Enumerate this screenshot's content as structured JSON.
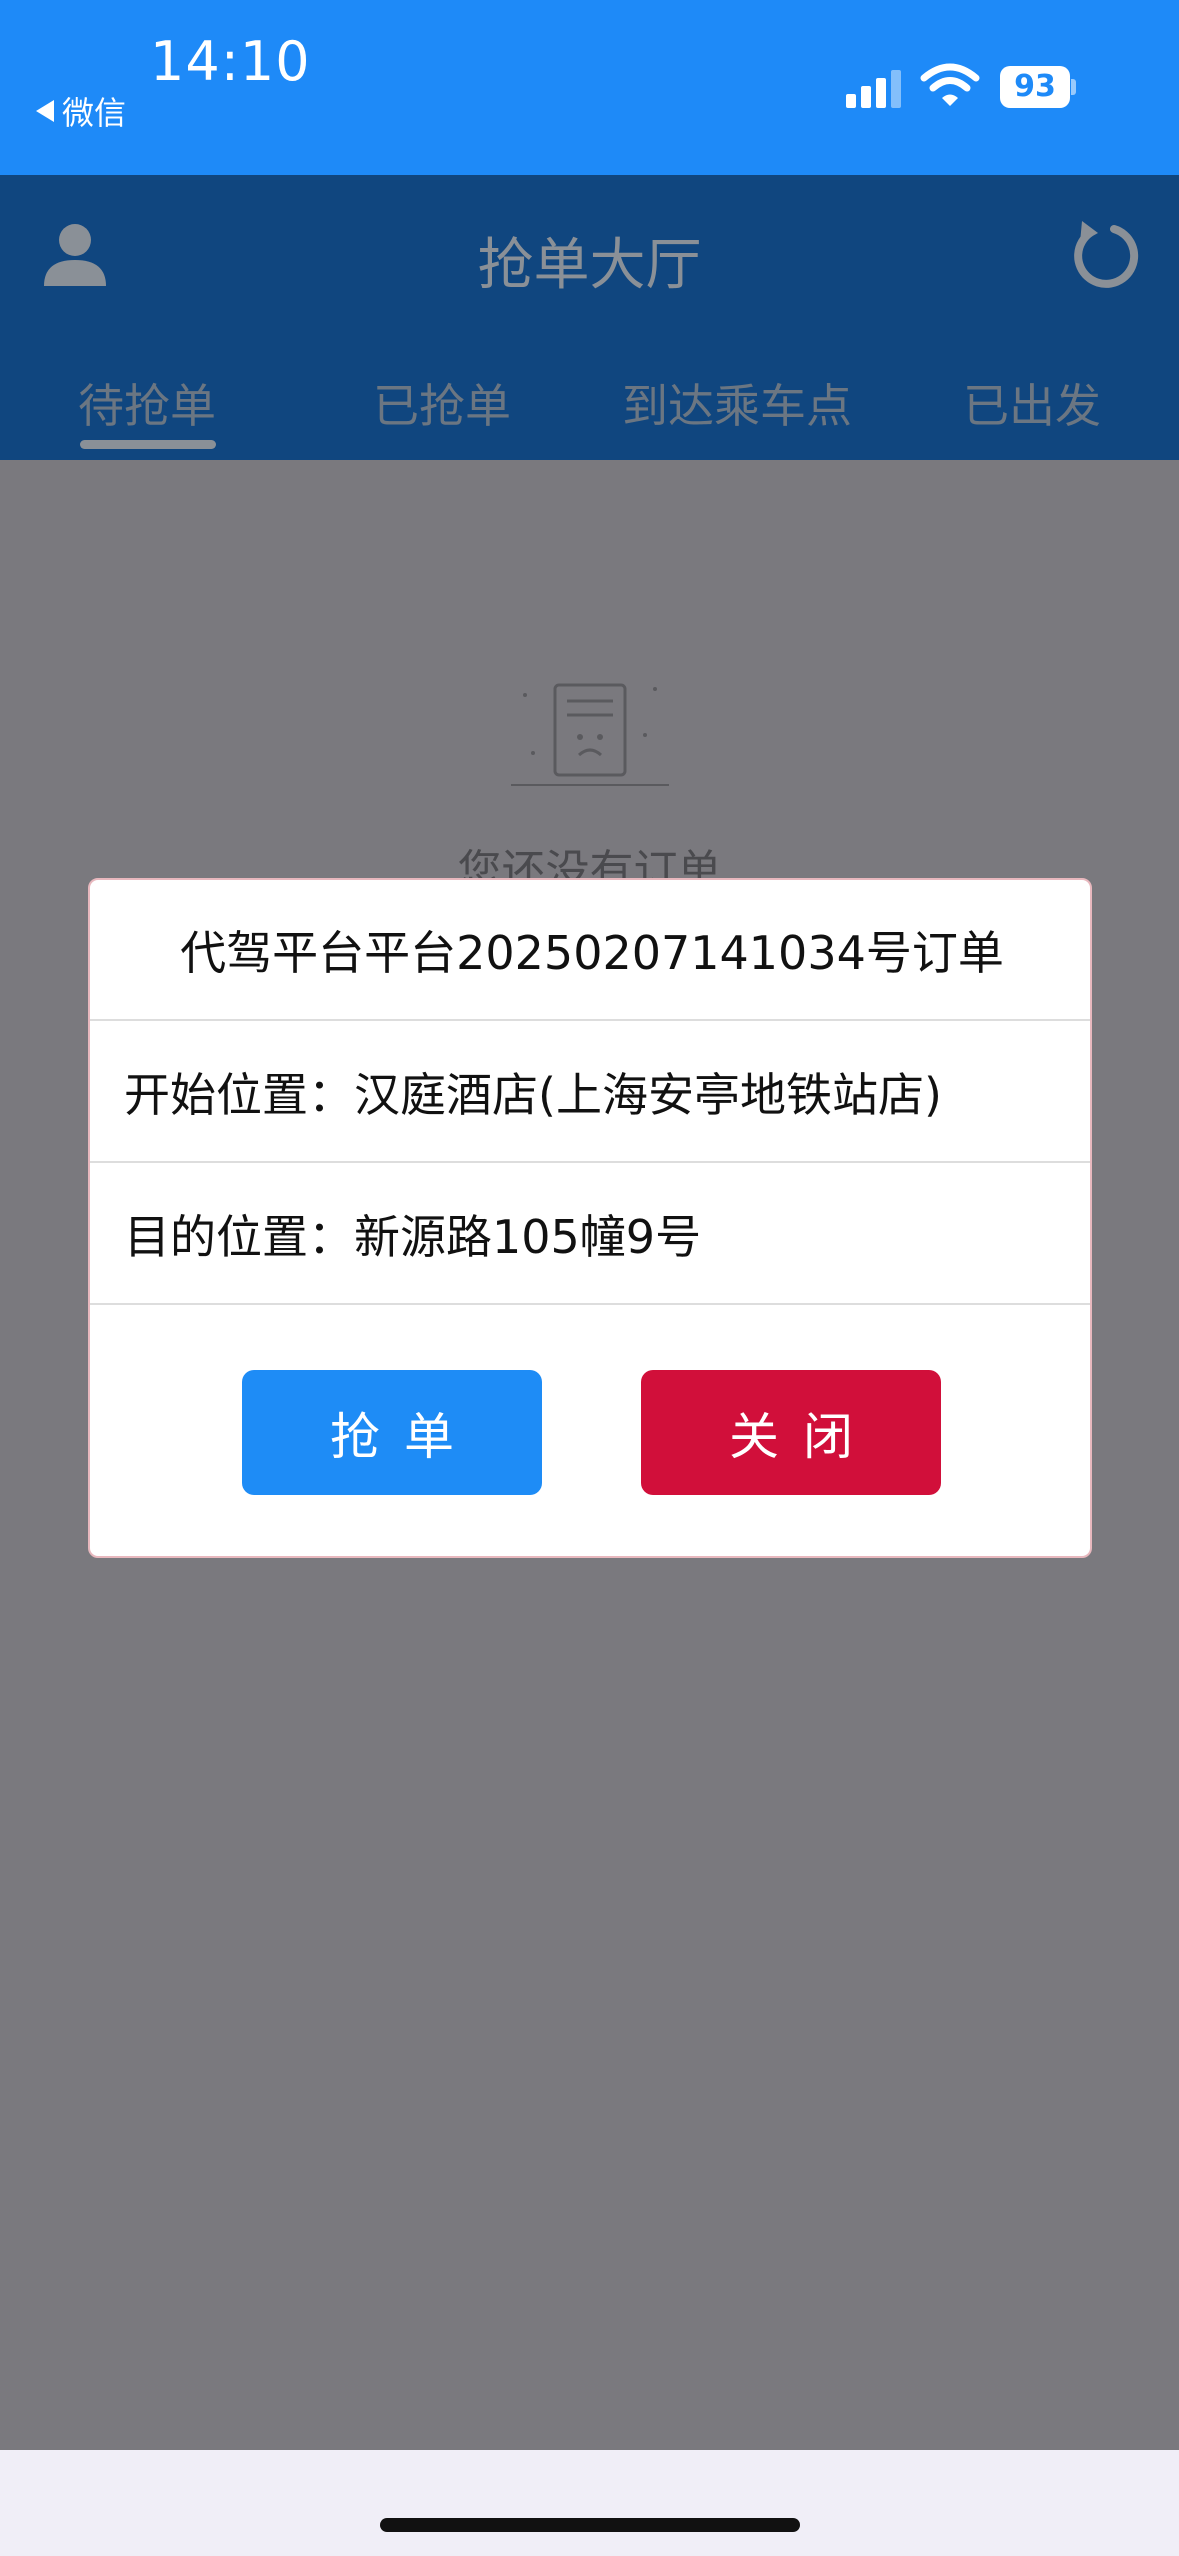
{
  "status_bar": {
    "time": "14:10",
    "back_app": "微信",
    "battery": "93",
    "icons": [
      "signal-icon",
      "wifi-icon",
      "battery-icon"
    ]
  },
  "header": {
    "title": "抢单大厅",
    "icons": [
      "user-icon",
      "refresh-icon"
    ]
  },
  "tabs": [
    {
      "label": "待抢单",
      "active": true
    },
    {
      "label": "已抢单",
      "active": false
    },
    {
      "label": "到达乘车点",
      "active": false
    },
    {
      "label": "已出发",
      "active": false
    }
  ],
  "empty_state": {
    "text": "您还没有订单",
    "icon": "empty-document-icon"
  },
  "modal": {
    "title": "代驾平台平台20250207141034号订单",
    "start_location": "开始位置：汉庭酒店(上海安亭地铁站店)",
    "destination": "目的位置：新源路105幢9号",
    "grab_button": "抢单",
    "close_button": "关闭"
  },
  "colors": {
    "status_bar": "#1e8af8",
    "header_dimmed": "#10467f",
    "overlay": "#7a797e",
    "grab_button": "#1e8cf6",
    "close_button": "#d10f3a"
  }
}
